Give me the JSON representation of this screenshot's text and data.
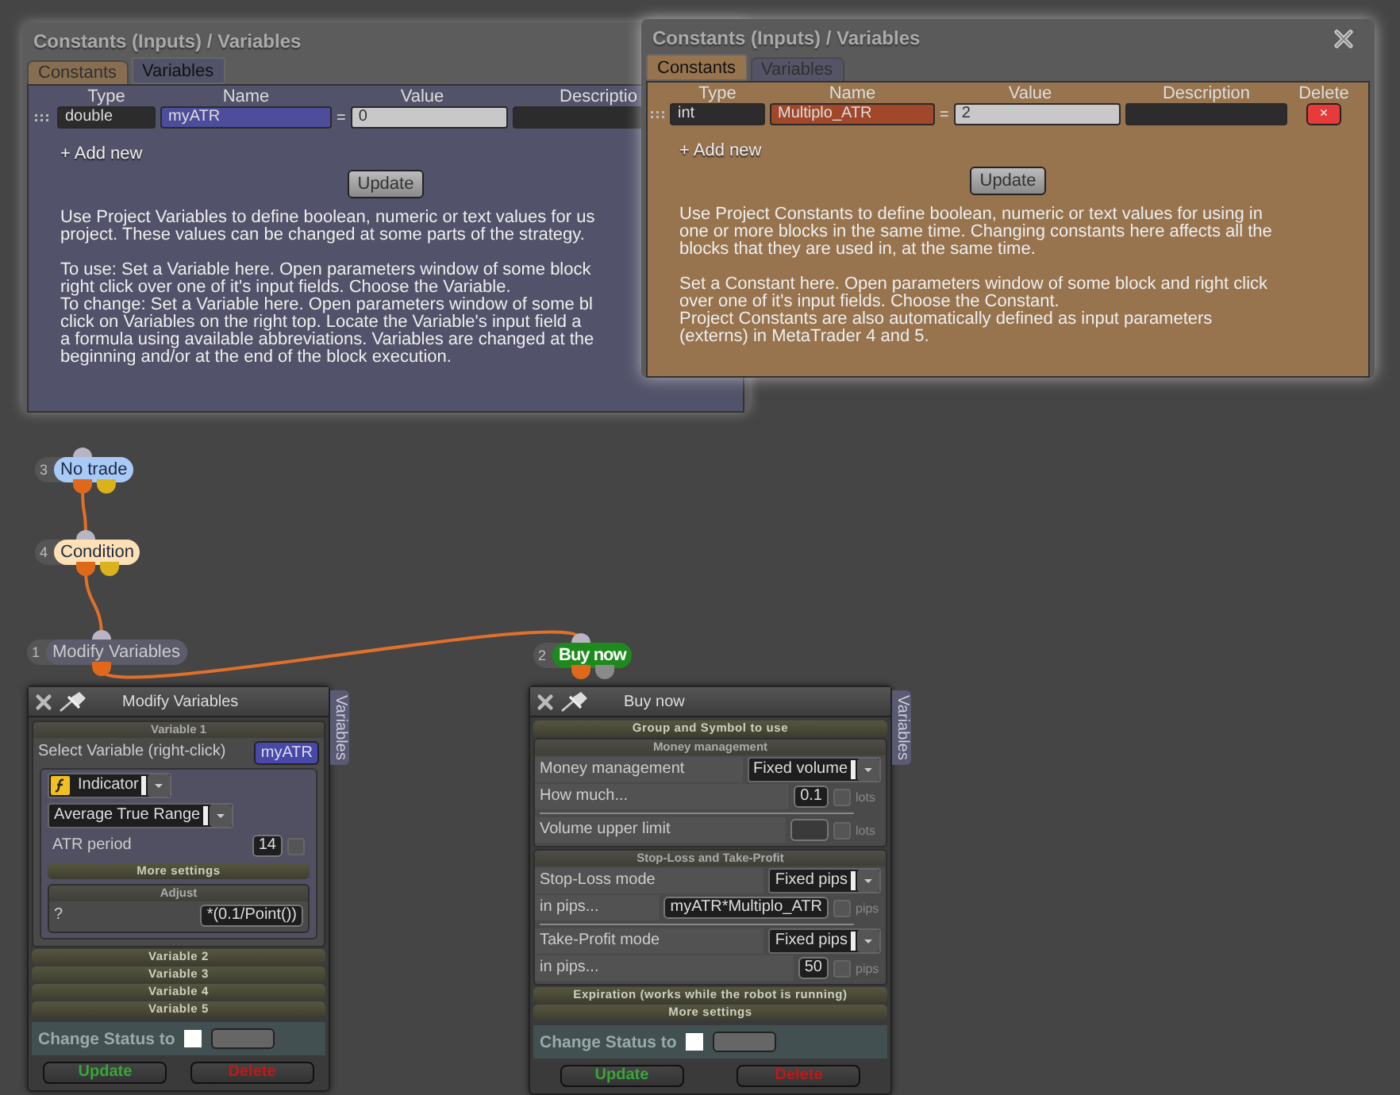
{
  "dialogs": [
    {
      "title": "Constants (Inputs) / Variables",
      "closable": false,
      "tabs": [
        {
          "label": "Constants",
          "kind": "constants",
          "selected": false
        },
        {
          "label": "Variables",
          "kind": "variables",
          "selected": true
        }
      ],
      "columns": [
        "Type",
        "Name",
        "Value",
        "Descriptio"
      ],
      "rows": [
        {
          "type": "double",
          "name": "myATR",
          "operator": "=",
          "value": "0"
        }
      ],
      "add_new": "+ Add new",
      "update": "Update",
      "paragraphs": [
        [
          "Use Project Variables to define boolean, numeric or text values for us",
          "project. These values can be changed at some parts of the strategy."
        ],
        [
          "To use: Set a Variable here. Open parameters window of some block",
          "right click over one of it's input fields. Choose the Variable.",
          "To change: Set a Variable here. Open parameters window of some bl",
          "click on Variables on the right top. Locate the Variable's input field a",
          "a formula using available abbreviations. Variables are changed at the",
          "beginning and/or at the end of the block execution."
        ]
      ]
    },
    {
      "title": "Constants (Inputs) / Variables",
      "closable": true,
      "tabs": [
        {
          "label": "Constants",
          "kind": "constants",
          "selected": true
        },
        {
          "label": "Variables",
          "kind": "variables",
          "selected": false
        }
      ],
      "columns": [
        "Type",
        "Name",
        "Value",
        "Description",
        "Delete"
      ],
      "rows": [
        {
          "type": "int",
          "name": "Multiplo_ATR",
          "operator": "=",
          "value": "2",
          "delete": "×"
        }
      ],
      "add_new": "+ Add new",
      "update": "Update",
      "paragraphs": [
        [
          "Use Project Constants to define boolean, numeric or text values for using in",
          "one or more blocks in the same time. Changing constants here affects all the",
          "blocks that they are used in, at the same time."
        ],
        [
          "Set a Constant here. Open parameters window of some block and right click",
          "over one of it's input fields. Choose the Constant.",
          "Project Constants are also automatically defined as input parameters",
          "(externs) in MetaTrader 4 and 5."
        ]
      ]
    }
  ],
  "nodes": [
    {
      "number": "3",
      "label": "No trade",
      "color": "#a9c9f7",
      "outputs": [
        {
          "color": "#e0681a"
        },
        {
          "color": "#d9b21c"
        }
      ]
    },
    {
      "number": "4",
      "label": "Condition",
      "color": "#fde0b6",
      "outputs": [
        {
          "color": "#e0681a"
        },
        {
          "color": "#d9b21c"
        }
      ]
    },
    {
      "number": "1",
      "label": "Modify Variables",
      "color": "#5c5c6c",
      "outputs": [
        {
          "color": "#e0681a"
        }
      ]
    },
    {
      "number": "2",
      "label": "Buy now",
      "color": "#1d8a1d",
      "outputs": [
        {
          "color": "#e0681a"
        },
        {
          "color": "#8a8a8a"
        }
      ]
    }
  ],
  "blocks": [
    {
      "title": "Modify Variables",
      "side_tab": "Variables",
      "sections": [
        {
          "kind": "group",
          "title": "Variable 1",
          "rows": [
            {
              "kind": "chip",
              "label": "Select Variable (right-click)",
              "value": "myATR"
            },
            {
              "kind": "panel",
              "rows": [
                {
                  "kind": "function-select",
                  "value": "Indicator"
                },
                {
                  "kind": "select",
                  "value": "Average True Range"
                },
                {
                  "kind": "input",
                  "label": "ATR period",
                  "value": "14",
                  "checked": false
                },
                {
                  "kind": "bar",
                  "title": "More settings"
                },
                {
                  "kind": "group",
                  "title": "Adjust",
                  "rows": [
                    {
                      "kind": "input",
                      "label": "?",
                      "value": "*(0.1/Point())"
                    }
                  ]
                }
              ]
            }
          ]
        },
        {
          "kind": "bar",
          "title": "Variable 2"
        },
        {
          "kind": "bar",
          "title": "Variable 3"
        },
        {
          "kind": "bar",
          "title": "Variable 4"
        },
        {
          "kind": "bar",
          "title": "Variable 5"
        }
      ],
      "status_label": "Change Status to",
      "buttons": [
        {
          "label": "Update",
          "kind": "update"
        },
        {
          "label": "Delete",
          "kind": "delete"
        }
      ]
    },
    {
      "title": "Buy now",
      "side_tab": "Variables",
      "sections": [
        {
          "kind": "bar",
          "title": "Group and Symbol to use"
        },
        {
          "kind": "group",
          "title": "Money management",
          "rows": [
            {
              "kind": "select",
              "label": "Money management",
              "value": "Fixed volume"
            },
            {
              "kind": "input",
              "label": "How much...",
              "value": "0.1",
              "checked": false,
              "unit": "lots"
            },
            {
              "kind": "input",
              "label": "Volume upper limit",
              "checked": false,
              "unit": "lots",
              "separated": true
            }
          ]
        },
        {
          "kind": "group",
          "title": "Stop-Loss and Take-Profit",
          "rows": [
            {
              "kind": "select",
              "label": "Stop-Loss mode",
              "value": "Fixed pips"
            },
            {
              "kind": "input",
              "label": "in pips...",
              "value": "myATR*Multiplo_ATR",
              "checked": false,
              "unit": "pips"
            },
            {
              "kind": "select",
              "label": "Take-Profit mode",
              "value": "Fixed pips",
              "separated": true
            },
            {
              "kind": "input",
              "label": "in pips...",
              "value": "50",
              "checked": false,
              "unit": "pips"
            }
          ]
        },
        {
          "kind": "bar",
          "title": "Expiration (works while the robot is running)"
        },
        {
          "kind": "bar",
          "title": "More settings"
        }
      ],
      "status_label": "Change Status to",
      "buttons": [
        {
          "label": "Update",
          "kind": "update"
        },
        {
          "label": "Delete",
          "kind": "delete"
        }
      ]
    }
  ]
}
